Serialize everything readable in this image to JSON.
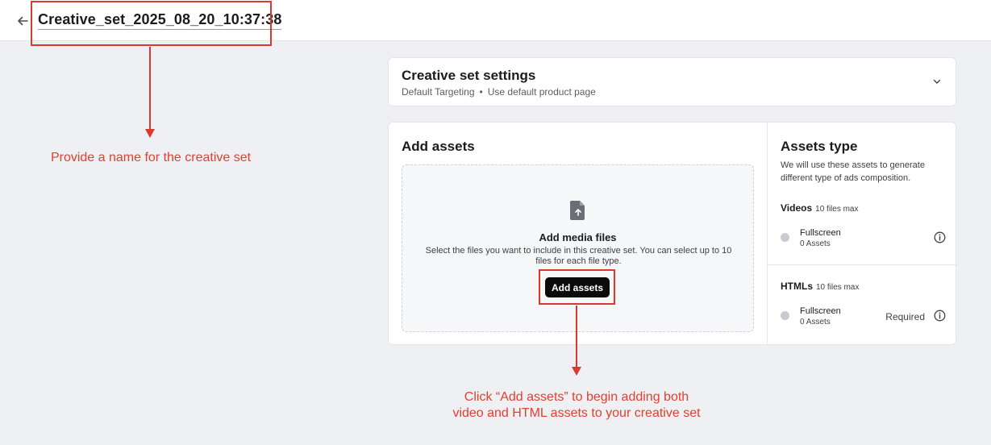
{
  "header": {
    "back_icon": "arrow-left-icon",
    "title": "Creative_set_2025_08_20_10:37:38"
  },
  "annotations": {
    "name_hint": "Provide a name for the creative set",
    "add_hint_line1": "Click “Add assets” to begin adding both",
    "add_hint_line2": "video and HTML assets to your creative set",
    "color": "#e0402f"
  },
  "settings": {
    "title": "Creative set settings",
    "targeting": "Default Targeting",
    "separator": "•",
    "product_page": "Use default product page",
    "chevron_icon": "chevron-down-icon"
  },
  "add_assets": {
    "title": "Add assets",
    "dropzone_icon": "file-upload-icon",
    "dropzone_title": "Add media files",
    "dropzone_desc": "Select the files you want to include in this creative set. You can select up to 10 files for each file type.",
    "button_label": "Add assets"
  },
  "assets_type": {
    "title": "Assets type",
    "description": "We will use these assets to generate different type of ads composition.",
    "videos": {
      "label": "Videos",
      "max": "10 files max",
      "row": {
        "name": "Fullscreen",
        "count": "0 Assets",
        "info_icon": "info-icon"
      }
    },
    "htmls": {
      "label": "HTMLs",
      "max": "10 files max",
      "row": {
        "name": "Fullscreen",
        "count": "0 Assets",
        "status": "Required",
        "info_icon": "info-icon"
      }
    }
  }
}
